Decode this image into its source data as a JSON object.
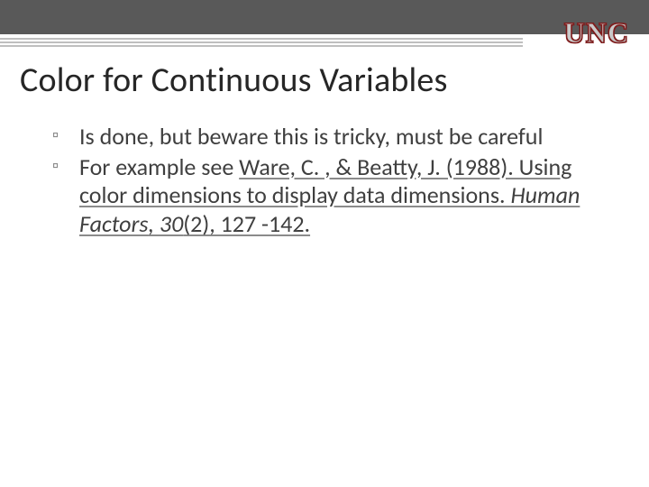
{
  "logo": "UNC",
  "title": "Color for Continuous Variables",
  "bullets": [
    {
      "text": "Is done, but beware this is tricky, must be careful"
    },
    {
      "prefix": "For example see ",
      "ref_plain": "Ware, C. , & Beatty, J. (1988). Using color dimensions to display data dimensions. ",
      "ref_journal": "Human Factors",
      "ref_vol": ", 30",
      "ref_rest": "(2), 127 -142. "
    }
  ]
}
